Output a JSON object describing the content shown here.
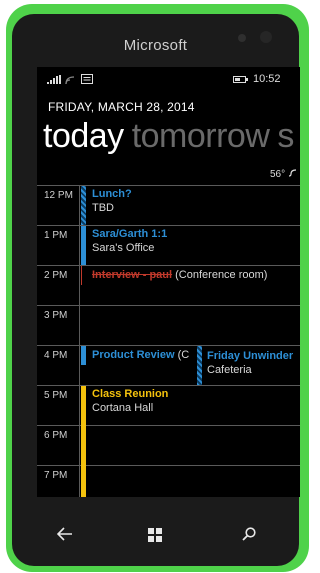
{
  "device": {
    "brand": "Microsoft"
  },
  "status": {
    "time": "10:52"
  },
  "header": {
    "date": "FRIDAY, MARCH 28, 2014",
    "pivot_active": "today",
    "pivot_next": "tomorrow",
    "pivot_peek": "s"
  },
  "weather": {
    "temp": "56°",
    "icon": "cloud-icon"
  },
  "hours": [
    "12 PM",
    "1 PM",
    "2 PM",
    "3 PM",
    "4 PM",
    "5 PM",
    "6 PM",
    "7 PM"
  ],
  "events": [
    {
      "title": "Lunch?",
      "location": "TBD",
      "status": "tentative",
      "color": "#2d8fd6"
    },
    {
      "title": "Sara/Garth 1:1",
      "location": "Sara's Office",
      "status": "busy",
      "color": "#2d8fd6"
    },
    {
      "title": "Interview - paul",
      "location": "(Conference room)",
      "status": "canceled",
      "color": "#c0392b"
    },
    {
      "title": "Product Review",
      "location": "(C",
      "status": "busy",
      "color": "#2d8fd6"
    },
    {
      "title": "Friday Unwinder",
      "location": "Cafeteria",
      "status": "tentative",
      "color": "#2d8fd6"
    },
    {
      "title": "Class Reunion",
      "location": "Cortana Hall",
      "status": "busy",
      "color": "#f4c20d"
    }
  ],
  "nav": {
    "back_icon": "back-arrow-icon",
    "start_icon": "windows-logo-icon",
    "search_icon": "search-icon"
  },
  "colors": {
    "phone_shell": "#4fd24a",
    "accent_blue": "#2d8fd6",
    "accent_red": "#c0392b",
    "accent_yellow": "#f4c20d"
  }
}
